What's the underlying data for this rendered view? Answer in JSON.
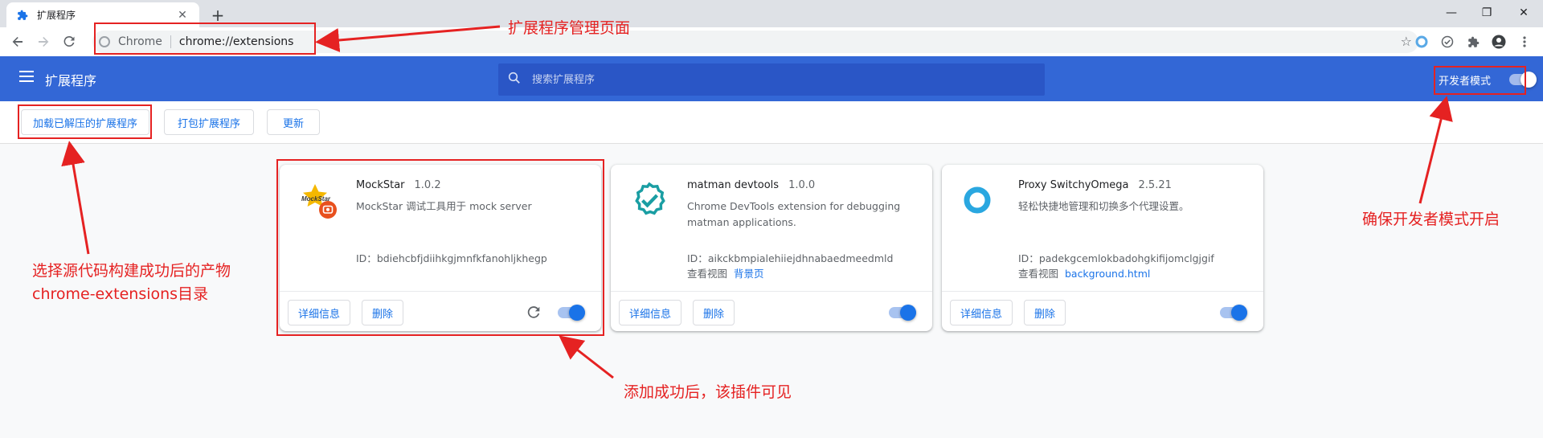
{
  "tab": {
    "title": "扩展程序",
    "close": "✕",
    "new_tab": "+"
  },
  "window": {
    "minimize": "—",
    "restore": "❐",
    "close": "✕"
  },
  "omnibox": {
    "chip": "Chrome",
    "url": "chrome://extensions"
  },
  "header": {
    "title": "扩展程序",
    "search_placeholder": "搜索扩展程序",
    "dev_mode_label": "开发者模式",
    "dev_mode_on": true
  },
  "actions": {
    "load_unpacked": "加载已解压的扩展程序",
    "pack": "打包扩展程序",
    "update": "更新"
  },
  "extensions": [
    {
      "name": "MockStar",
      "version": "1.0.2",
      "description": "MockStar 调试工具用于 mock server",
      "id_label": "ID：",
      "id": "bdiehcbfjdiihkgjmnfkfanohljkhegp",
      "details_label": "详细信息",
      "remove_label": "删除",
      "icon_text": "MockStar",
      "enabled": true
    },
    {
      "name": "matman devtools",
      "version": "1.0.0",
      "description": "Chrome DevTools extension for debugging matman applications.",
      "id_label": "ID：",
      "id": "aikckbmpialehiiejdhnabaedmeedmld",
      "views_label": "查看视图",
      "view_link": "背景页",
      "details_label": "详细信息",
      "remove_label": "删除",
      "enabled": true
    },
    {
      "name": "Proxy SwitchyOmega",
      "version": "2.5.21",
      "description": "轻松快捷地管理和切换多个代理设置。",
      "id_label": "ID：",
      "id": "padekgcemlokbadohgkifijomclgjgif",
      "views_label": "查看视图",
      "view_link": "background.html",
      "details_label": "详细信息",
      "remove_label": "删除",
      "enabled": true
    }
  ],
  "annotations": {
    "manage_page": "扩展程序管理页面",
    "dev_mode_on": "确保开发者模式开启",
    "select_dir_line1": "选择源代码构建成功后的产物",
    "select_dir_line2": "chrome-extensions目录",
    "added_visible": "添加成功后，该插件可见"
  },
  "colors": {
    "header_blue": "#3367d6",
    "accent": "#1a73e8",
    "annotation_red": "#e52222"
  }
}
